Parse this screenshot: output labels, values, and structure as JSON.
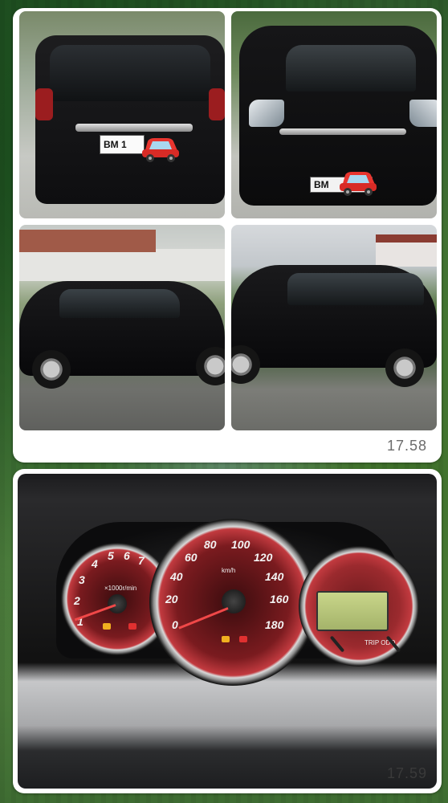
{
  "messages": [
    {
      "time": "17.58",
      "photos": [
        {
          "plate": "BM 1"
        },
        {
          "plate": "BM"
        },
        {},
        {}
      ]
    },
    {
      "time": "17.59",
      "dashboard": {
        "tach_ticks": [
          "1",
          "2",
          "3",
          "4",
          "5",
          "6",
          "7"
        ],
        "tach_unit": "×1000r/min",
        "speed_ticks": [
          "20",
          "40",
          "60",
          "80",
          "100",
          "120",
          "140",
          "160",
          "180"
        ],
        "speed_zero": "0",
        "speed_unit": "km/h",
        "trip_unit": "TRIP ODO"
      }
    }
  ],
  "colors": {
    "bubble": "#ffffff",
    "timestamp": "#6b6b6b",
    "car_emoji": "#e8352f"
  },
  "icons": [
    "red-car-emoji"
  ]
}
